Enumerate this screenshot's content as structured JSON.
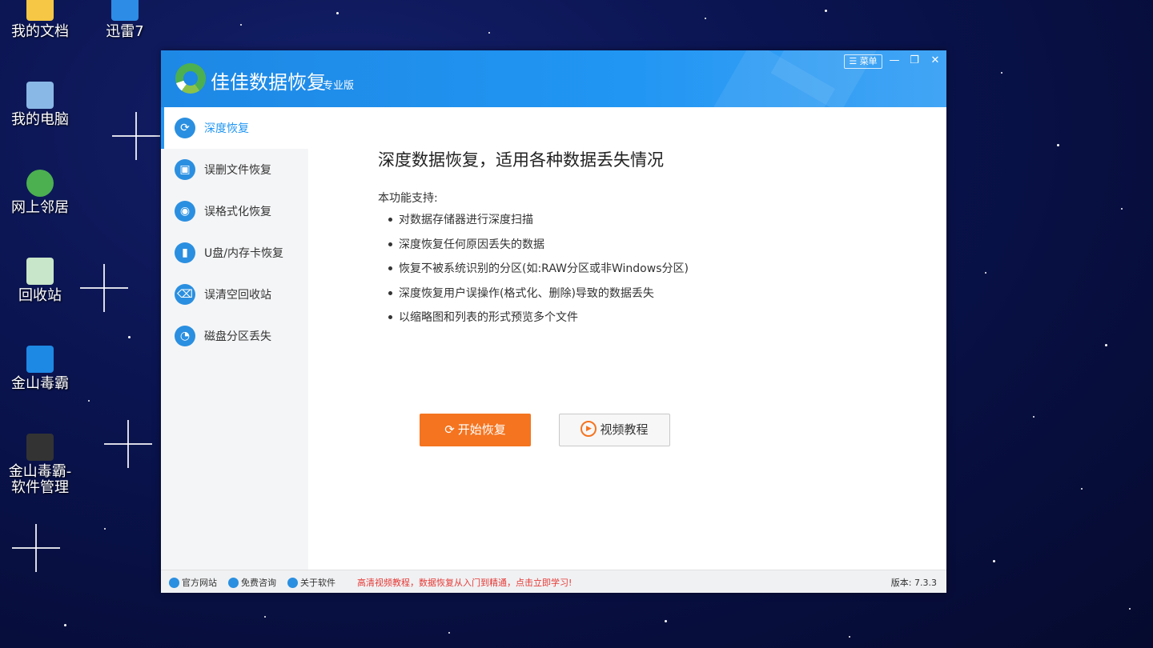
{
  "desktop": {
    "icons": [
      {
        "label": "我的文档"
      },
      {
        "label": "迅雷7"
      },
      {
        "label": "我的电脑"
      },
      {
        "label": "网上邻居"
      },
      {
        "label": "回收站"
      },
      {
        "label": "金山毒霸"
      },
      {
        "label": "金山毒霸-软件管理"
      }
    ]
  },
  "window": {
    "title": "佳佳数据恢复",
    "edition": "专业版",
    "menu_label": "菜单",
    "minimize_glyph": "—",
    "restore_glyph": "❐",
    "close_glyph": "✕"
  },
  "sidebar": {
    "items": [
      {
        "label": "深度恢复",
        "icon": "refresh-icon",
        "glyph": "⟳",
        "active": true
      },
      {
        "label": "误删文件恢复",
        "icon": "folder-icon",
        "glyph": "▣",
        "active": false
      },
      {
        "label": "误格式化恢复",
        "icon": "disk-icon",
        "glyph": "◉",
        "active": false
      },
      {
        "label": "U盘/内存卡恢复",
        "icon": "usb-icon",
        "glyph": "▮",
        "active": false
      },
      {
        "label": "误清空回收站",
        "icon": "trash-icon",
        "glyph": "⌫",
        "active": false
      },
      {
        "label": "磁盘分区丢失",
        "icon": "partition-icon",
        "glyph": "◔",
        "active": false
      }
    ]
  },
  "main": {
    "heading": "深度数据恢复，适用各种数据丢失情况",
    "support_label": "本功能支持:",
    "features": [
      "对数据存储器进行深度扫描",
      "深度恢复任何原因丢失的数据",
      "恢复不被系统识别的分区(如:RAW分区或非Windows分区)",
      "深度恢复用户误操作(格式化、删除)导致的数据丢失",
      "以缩略图和列表的形式预览多个文件"
    ],
    "start_button": "开始恢复",
    "start_glyph": "⟳",
    "video_button": "视频教程",
    "video_glyph": "▶"
  },
  "statusbar": {
    "links": [
      "官方网站",
      "免费咨询",
      "关于软件"
    ],
    "promo": "高清视频教程，数据恢复从入门到精通，点击立即学习!",
    "version": "版本: 7.3.3"
  },
  "colors": {
    "titlebar": "#2196f3",
    "accent": "#2196f3",
    "start_button": "#f5741f",
    "promo_text": "#e53935"
  }
}
